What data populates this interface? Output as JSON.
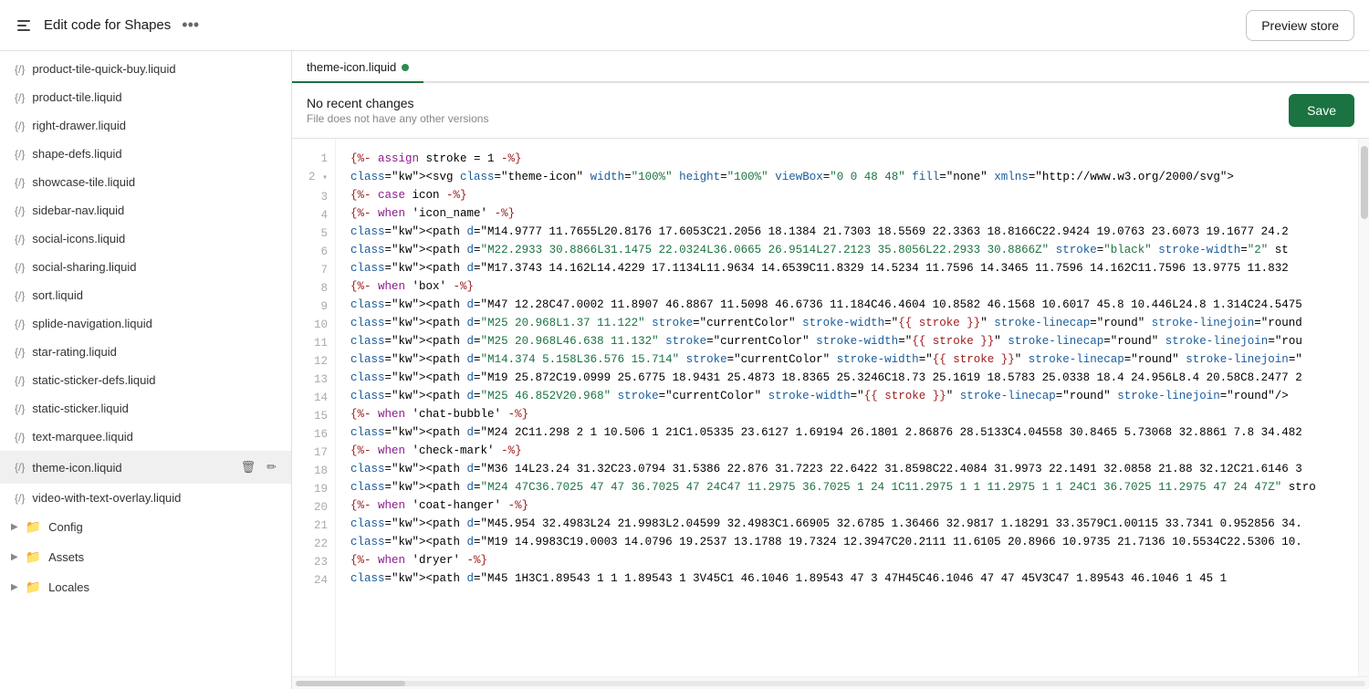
{
  "topbar": {
    "back_icon": "←",
    "title": "Edit code for Shapes",
    "more_icon": "•••",
    "preview_store_label": "Preview store"
  },
  "sidebar": {
    "items": [
      {
        "name": "product-tile-quick-buy.liquid",
        "icon": "{/}"
      },
      {
        "name": "product-tile.liquid",
        "icon": "{/}"
      },
      {
        "name": "right-drawer.liquid",
        "icon": "{/}"
      },
      {
        "name": "shape-defs.liquid",
        "icon": "{/}"
      },
      {
        "name": "showcase-tile.liquid",
        "icon": "{/}"
      },
      {
        "name": "sidebar-nav.liquid",
        "icon": "{/}"
      },
      {
        "name": "social-icons.liquid",
        "icon": "{/}"
      },
      {
        "name": "social-sharing.liquid",
        "icon": "{/}"
      },
      {
        "name": "sort.liquid",
        "icon": "{/}"
      },
      {
        "name": "splide-navigation.liquid",
        "icon": "{/}"
      },
      {
        "name": "star-rating.liquid",
        "icon": "{/}"
      },
      {
        "name": "static-sticker-defs.liquid",
        "icon": "{/}"
      },
      {
        "name": "static-sticker.liquid",
        "icon": "{/}"
      },
      {
        "name": "text-marquee.liquid",
        "icon": "{/}"
      },
      {
        "name": "theme-icon.liquid",
        "icon": "{/}",
        "active": true
      },
      {
        "name": "video-with-text-overlay.liquid",
        "icon": "{/}"
      }
    ],
    "folders": [
      {
        "name": "Config"
      },
      {
        "name": "Assets"
      },
      {
        "name": "Locales"
      }
    ]
  },
  "editor": {
    "tab_name": "theme-icon.liquid",
    "tab_dot_color": "#2d8a50",
    "save_bar": {
      "title": "No recent changes",
      "subtitle": "File does not have any other versions"
    },
    "save_label": "Save",
    "lines": [
      {
        "num": 1,
        "code": "{%- assign stroke = 1 -%}",
        "type": "liquid"
      },
      {
        "num": 2,
        "code": "<svg class=\"theme-icon\" width=\"100%\" height=\"100%\" viewBox=\"0 0 48 48\" fill=\"none\" xmlns=\"http://www.w3.org/2000/svg\">",
        "type": "html",
        "collapse": true
      },
      {
        "num": 3,
        "code": "  {%- case icon -%}",
        "type": "liquid"
      },
      {
        "num": 4,
        "code": "    {%- when 'icon_name' -%}",
        "type": "liquid"
      },
      {
        "num": 5,
        "code": "      <path d=\"M14.9777 11.7655L20.8176 17.6053C21.2056 18.1384 21.7303 18.5569 22.3363 18.8166C22.9424 19.0763 23.6073 19.1677 24.2",
        "type": "html"
      },
      {
        "num": 6,
        "code": "      <path d=\"M22.2933 30.8866L31.1475 22.0324L36.0665 26.9514L27.2123 35.8056L22.2933 30.8866Z\" stroke=\"black\" stroke-width=\"2\" st",
        "type": "html"
      },
      {
        "num": 7,
        "code": "      <path d=\"M17.3743 14.162L14.4229 17.1134L11.9634 14.6539C11.8329 14.5234 11.7596 14.3465 11.7596 14.162C11.7596 13.9775 11.832",
        "type": "html"
      },
      {
        "num": 8,
        "code": "    {%- when 'box' -%}",
        "type": "liquid"
      },
      {
        "num": 9,
        "code": "      <path d=\"M47 12.28C47.0002 11.8907 46.8867 11.5098 46.6736 11.184C46.4604 10.8582 46.1568 10.6017 45.8 10.446L24.8 1.314C24.5475",
        "type": "html"
      },
      {
        "num": 10,
        "code": "      <path d=\"M25 20.968L1.37 11.122\" stroke=\"currentColor\" stroke-width=\"{{ stroke }}\" stroke-linecap=\"round\" stroke-linejoin=\"round",
        "type": "html"
      },
      {
        "num": 11,
        "code": "      <path d=\"M25 20.968L46.638 11.132\" stroke=\"currentColor\" stroke-width=\"{{ stroke }}\" stroke-linecap=\"round\" stroke-linejoin=\"rou",
        "type": "html"
      },
      {
        "num": 12,
        "code": "      <path d=\"M14.374 5.158L36.576 15.714\" stroke=\"currentColor\" stroke-width=\"{{ stroke }}\" stroke-linecap=\"round\" stroke-linejoin=\"",
        "type": "html"
      },
      {
        "num": 13,
        "code": "      <path d=\"M19 25.872C19.0999 25.6775 18.9431 25.4873 18.8365 25.3246C18.73 25.1619 18.5783 25.0338 18.4 24.956L8.4 20.58C8.2477 2",
        "type": "html"
      },
      {
        "num": 14,
        "code": "      <path d=\"M25 46.852V20.968\" stroke=\"currentColor\" stroke-width=\"{{ stroke }}\" stroke-linecap=\"round\" stroke-linejoin=\"round\"/>",
        "type": "html"
      },
      {
        "num": 15,
        "code": "    {%- when 'chat-bubble' -%}",
        "type": "liquid"
      },
      {
        "num": 16,
        "code": "      <path d=\"M24 2C11.298 2 1 10.506 1 21C1.05335 23.6127 1.69194 26.1801 2.86876 28.5133C4.04558 30.8465 5.73068 32.8861 7.8 34.482",
        "type": "html"
      },
      {
        "num": 17,
        "code": "    {%- when 'check-mark' -%}",
        "type": "liquid"
      },
      {
        "num": 18,
        "code": "      <path d=\"M36 14L23.24 31.32C23.0794 31.5386 22.876 31.7223 22.6422 31.8598C22.4084 31.9973 22.1491 32.0858 21.88 32.12C21.6146 3",
        "type": "html"
      },
      {
        "num": 19,
        "code": "      <path d=\"M24 47C36.7025 47 47 36.7025 47 24C47 11.2975 36.7025 1 24 1C11.2975 1 1 11.2975 1 1 24C1 36.7025 11.2975 47 24 47Z\" stro",
        "type": "html"
      },
      {
        "num": 20,
        "code": "    {%- when 'coat-hanger' -%}",
        "type": "liquid"
      },
      {
        "num": 21,
        "code": "      <path d=\"M45.954 32.4983L24 21.9983L2.04599 32.4983C1.66905 32.6785 1.36466 32.9817 1.18291 33.3579C1.00115 33.7341 0.952856 34.",
        "type": "html"
      },
      {
        "num": 22,
        "code": "      <path d=\"M19 14.9983C19.0003 14.0796 19.2537 13.1788 19.7324 12.3947C20.2111 11.6105 20.8966 10.9735 21.7136 10.5534C22.5306 10.",
        "type": "html"
      },
      {
        "num": 23,
        "code": "    {%- when 'dryer' -%}",
        "type": "liquid"
      },
      {
        "num": 24,
        "code": "      <path d=\"M45 1H3C1.89543 1 1 1.89543 1 3V45C1 46.1046 1.89543 47 3 47H45C46.1046 47 47 45V3C47 1.89543 46.1046 1 45 1",
        "type": "html"
      }
    ]
  }
}
